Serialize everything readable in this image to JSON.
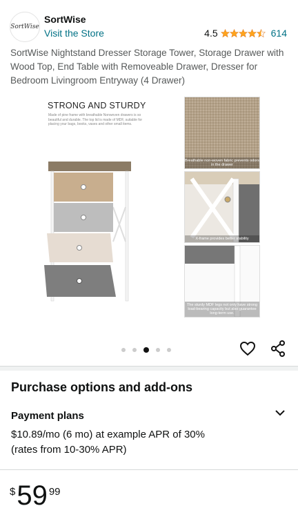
{
  "store": {
    "logo_text": "SortWise",
    "name": "SortWise",
    "visit_label": "Visit the Store",
    "rating": "4.5",
    "rating_count": "614"
  },
  "product": {
    "title": "SortWise Nightstand Dresser Storage Tower, Storage Drawer with Wood Top, End Table with Removeable Drawer, Dresser for Bedroom Livingroom Entryway (4 Drawer)"
  },
  "gallery": {
    "main_caption": "STRONG AND STURDY",
    "main_desc": "Made of pine frame with breathable Nonwoven drawers is so beautiful and durable. The top lid is made of MDF, suitable for placing your bags, books, vases and other small items.",
    "thumb1_caption": "Breathable non-woven fabric prevents odors in the drawer",
    "thumb2_caption": "X-frame provides better stability",
    "thumb3_caption": "The sturdy MDF legs not only have strong load-bearing capacity but also guarantee long-term use.",
    "dots_count": 5,
    "active_dot": 3
  },
  "purchase": {
    "section_title": "Purchase options and add-ons",
    "payment_title": "Payment plans",
    "payment_line1": "$10.89/mo (6 mo) at example APR of 30%",
    "payment_line2": "(rates from 10-30% APR)"
  },
  "price": {
    "currency": "$",
    "whole": "59",
    "fraction": "99"
  },
  "colors": {
    "link": "#007185",
    "star": "#ffa41c",
    "text": "#0f1111"
  }
}
